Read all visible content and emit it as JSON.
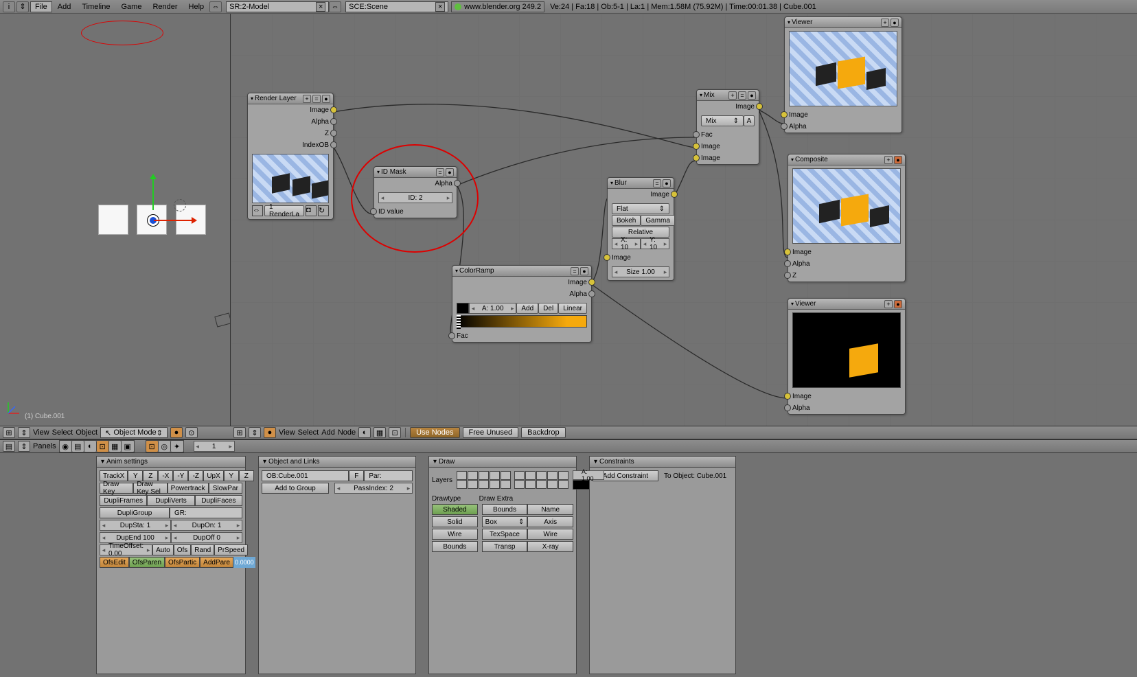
{
  "topbar": {
    "menus": {
      "file": "File",
      "add": "Add",
      "timeline": "Timeline",
      "game": "Game",
      "render": "Render",
      "help": "Help"
    },
    "screen_dd": "SR:2-Model",
    "scene_dd": "SCE:Scene",
    "url": "www.blender.org 249.2",
    "stats": "Ve:24 | Fa:18 | Ob:5-1 | La:1 | Mem:1.58M (75.92M) | Time:00:01.38 | Cube.001"
  },
  "view3d": {
    "obj_label": "(1) Cube.001"
  },
  "view3d_header": {
    "view": "View",
    "select": "Select",
    "object": "Object",
    "mode": "Object Mode"
  },
  "nodeed_header": {
    "view": "View",
    "select": "Select",
    "add": "Add",
    "node": "Node",
    "use_nodes": "Use Nodes",
    "free_unused": "Free Unused",
    "backdrop": "Backdrop"
  },
  "buttons_header": {
    "panels": "Panels",
    "frame": "1"
  },
  "nodes": {
    "renderlayer": {
      "title": "Render Layer",
      "outs": {
        "image": "Image",
        "alpha": "Alpha",
        "z": "Z",
        "indexob": "IndexOB"
      },
      "sel": "1 RenderLa"
    },
    "idmask": {
      "title": "ID Mask",
      "out_alpha": "Alpha",
      "id": "ID: 2",
      "in": "ID value"
    },
    "colorramp": {
      "title": "ColorRamp",
      "out_image": "Image",
      "out_alpha": "Alpha",
      "a": "A: 1.00",
      "add": "Add",
      "del": "Del",
      "linear": "Linear",
      "in": "Fac"
    },
    "blur": {
      "title": "Blur",
      "out": "Image",
      "type": "Flat",
      "bokeh": "Bokeh",
      "gamma": "Gamma",
      "relative": "Relative",
      "x": "X: 10",
      "y": "Y: 10",
      "size": "Size 1.00",
      "in": "Image"
    },
    "mix": {
      "title": "Mix",
      "out": "Image",
      "type": "Mix",
      "a": "A",
      "in_fac": "Fac",
      "in_img1": "Image",
      "in_img2": "Image"
    },
    "viewer1": {
      "title": "Viewer",
      "in_image": "Image",
      "in_alpha": "Alpha"
    },
    "composite": {
      "title": "Composite",
      "in_image": "Image",
      "in_alpha": "Alpha",
      "in_z": "Z"
    },
    "viewer2": {
      "title": "Viewer",
      "in_image": "Image",
      "in_alpha": "Alpha"
    }
  },
  "panels": {
    "anim": {
      "title": "Anim settings",
      "trackx": "TrackX",
      "y": "Y",
      "z": "Z",
      "mx": "-X",
      "my": "-Y",
      "mz": "-Z",
      "upx": "UpX",
      "upy": "Y",
      "upz": "Z",
      "drawkey": "Draw Key",
      "drawkeysel": "Draw Key Sel",
      "powertrack": "Powertrack",
      "slowpar": "SlowPar",
      "dupliframes": "DupliFrames",
      "dupliverts": "DupliVerts",
      "duplifaces": "DupliFaces",
      "dupligroup": "DupliGroup",
      "gr": "GR:",
      "dupsta": "DupSta: 1",
      "dupon": "DupOn: 1",
      "dupend": "DupEnd 100",
      "dupoff": "DupOff 0",
      "timeoffset": "TimeOffset: 0.00",
      "auto": "Auto",
      "ofs": "Ofs",
      "rand": "Rand",
      "prspeed": "PrSpeed",
      "ofsedit": "OfsEdit",
      "ofsparen": "OfsParen",
      "ofspartic": "OfsPartic",
      "addpare": "AddPare",
      "zero": "0.0000"
    },
    "objlinks": {
      "title": "Object and Links",
      "ob": "OB:Cube.001",
      "f": "F",
      "par": "Par:",
      "addgroup": "Add to Group",
      "passindex": "PassIndex: 2"
    },
    "draw": {
      "title": "Draw",
      "layers": "Layers",
      "a": "A: 1.00",
      "drawtype": "Drawtype",
      "drawextra": "Draw Extra",
      "shaded": "Shaded",
      "bounds": "Bounds",
      "name": "Name",
      "solid": "Solid",
      "box": "Box",
      "axis": "Axis",
      "wire": "Wire",
      "texspace": "TexSpace",
      "wire2": "Wire",
      "bounds2": "Bounds",
      "transp": "Transp",
      "xray": "X-ray"
    },
    "constraints": {
      "title": "Constraints",
      "add": "Add Constraint",
      "toobj": "To Object: Cube.001"
    }
  }
}
